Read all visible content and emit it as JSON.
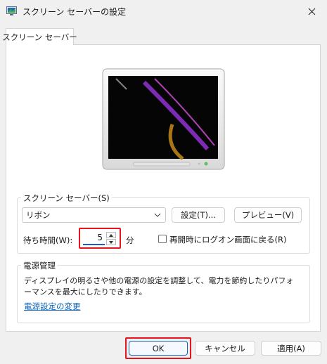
{
  "window": {
    "title": "スクリーン セーバーの設定",
    "icon": "screensaver-monitor-icon",
    "close_icon": "close-icon"
  },
  "tab": {
    "label": "スクリーン セーバー"
  },
  "preview": {
    "icon": "monitor-preview-image"
  },
  "screensaver_group": {
    "label": "スクリーン セーバー(S)",
    "selected": "リボン",
    "settings_button": "設定(T)...",
    "preview_button": "プレビュー(V)",
    "wait_label": "待ち時間(W):",
    "wait_value": "5",
    "wait_unit": "分",
    "resume_checkbox_label": "再開時にログオン画面に戻る(R)",
    "resume_checked": false
  },
  "power_group": {
    "label": "電源管理",
    "description_line1": "ディスプレイの明るさや他の電源の設定を調整して、電力を節約したりパフォ",
    "description_line2": "ーマンスを最大にしたりできます。",
    "link": "電源設定の変更"
  },
  "buttons": {
    "ok": "OK",
    "cancel": "キャンセル",
    "apply": "適用(A)"
  },
  "colors": {
    "highlight_box": "#e8141d",
    "link": "#0b63b7",
    "focus": "#1a5fbf"
  }
}
